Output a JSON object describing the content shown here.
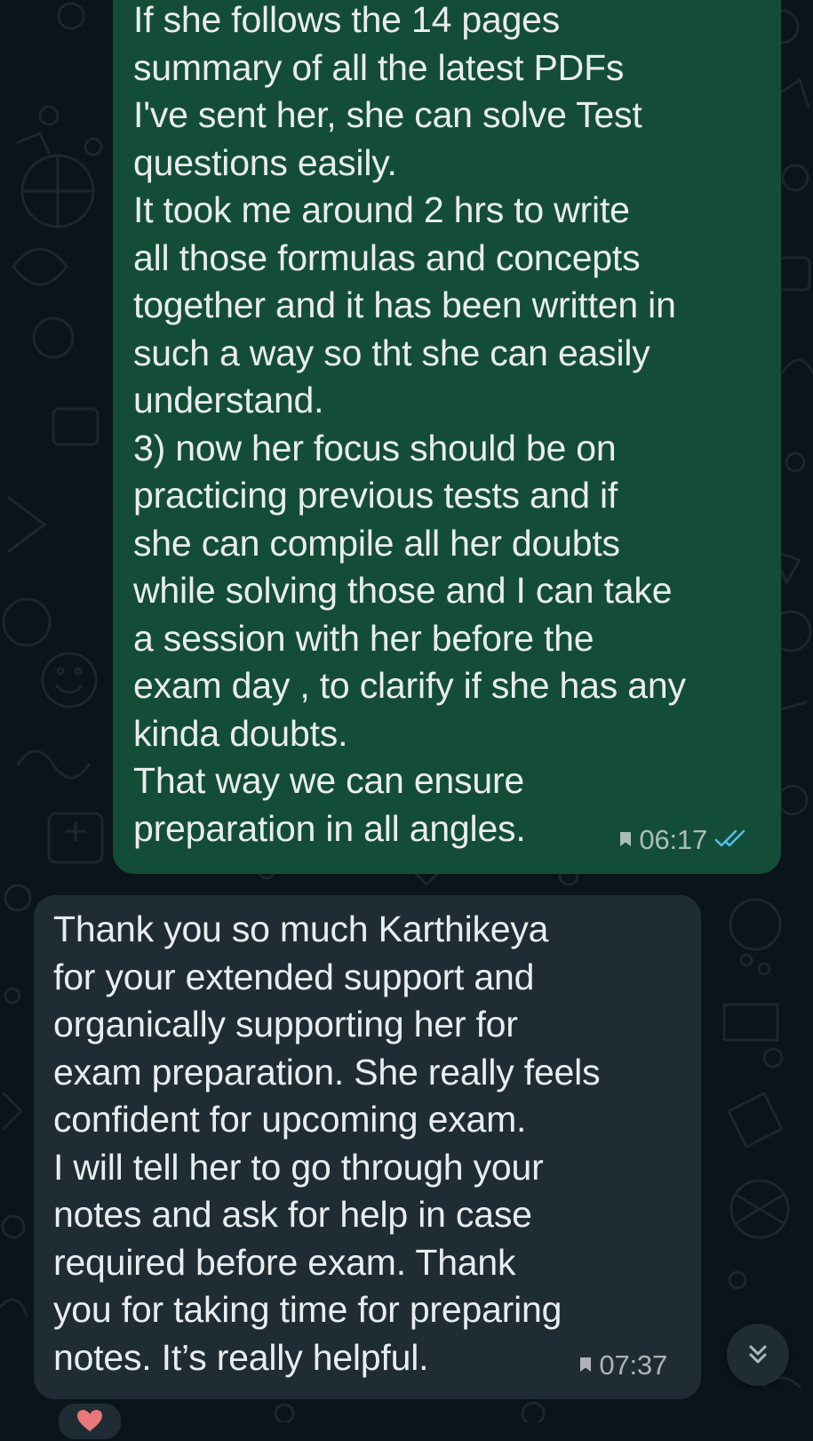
{
  "chat": {
    "messages": [
      {
        "direction": "outgoing",
        "lines": [
          "If she follows the 14 pages",
          "summary of all the latest PDFs",
          "I've sent her, she can solve Test",
          "questions easily.",
          "It took me around 2 hrs to write",
          "all those formulas and concepts",
          "together and it has been written in",
          "such a way so tht she can easily",
          "understand.",
          "3) now her focus should be on",
          "practicing previous tests and if",
          "she can compile all her doubts",
          "while solving those and I can take",
          "a session with her before the",
          "exam day , to clarify if she has any",
          "kinda doubts.",
          "That way we can ensure",
          "preparation in all angles."
        ],
        "time": "06:17",
        "pinned": true,
        "status": "read",
        "status_color": "#53bdeb"
      },
      {
        "direction": "incoming",
        "lines": [
          "Thank you so much Karthikeya",
          "for your extended support and",
          "organically supporting her for",
          "exam preparation. She really feels",
          "confident for upcoming exam.",
          "I will tell her to go through your",
          "notes and ask for help in case",
          "required before exam. Thank",
          "you for taking time for preparing",
          "notes. It’s really helpful."
        ],
        "time": "07:37",
        "pinned": true,
        "reaction": "heart-icon"
      }
    ]
  },
  "controls": {
    "scroll_to_bottom_icon": "double-chevron-down-icon"
  },
  "colors": {
    "background": "#0b141a",
    "outgoing_bubble": "#144d37",
    "incoming_bubble": "#1f2c34",
    "text": "#e9edef",
    "read_ticks": "#53bdeb",
    "reaction_heart": "#e8787a"
  }
}
